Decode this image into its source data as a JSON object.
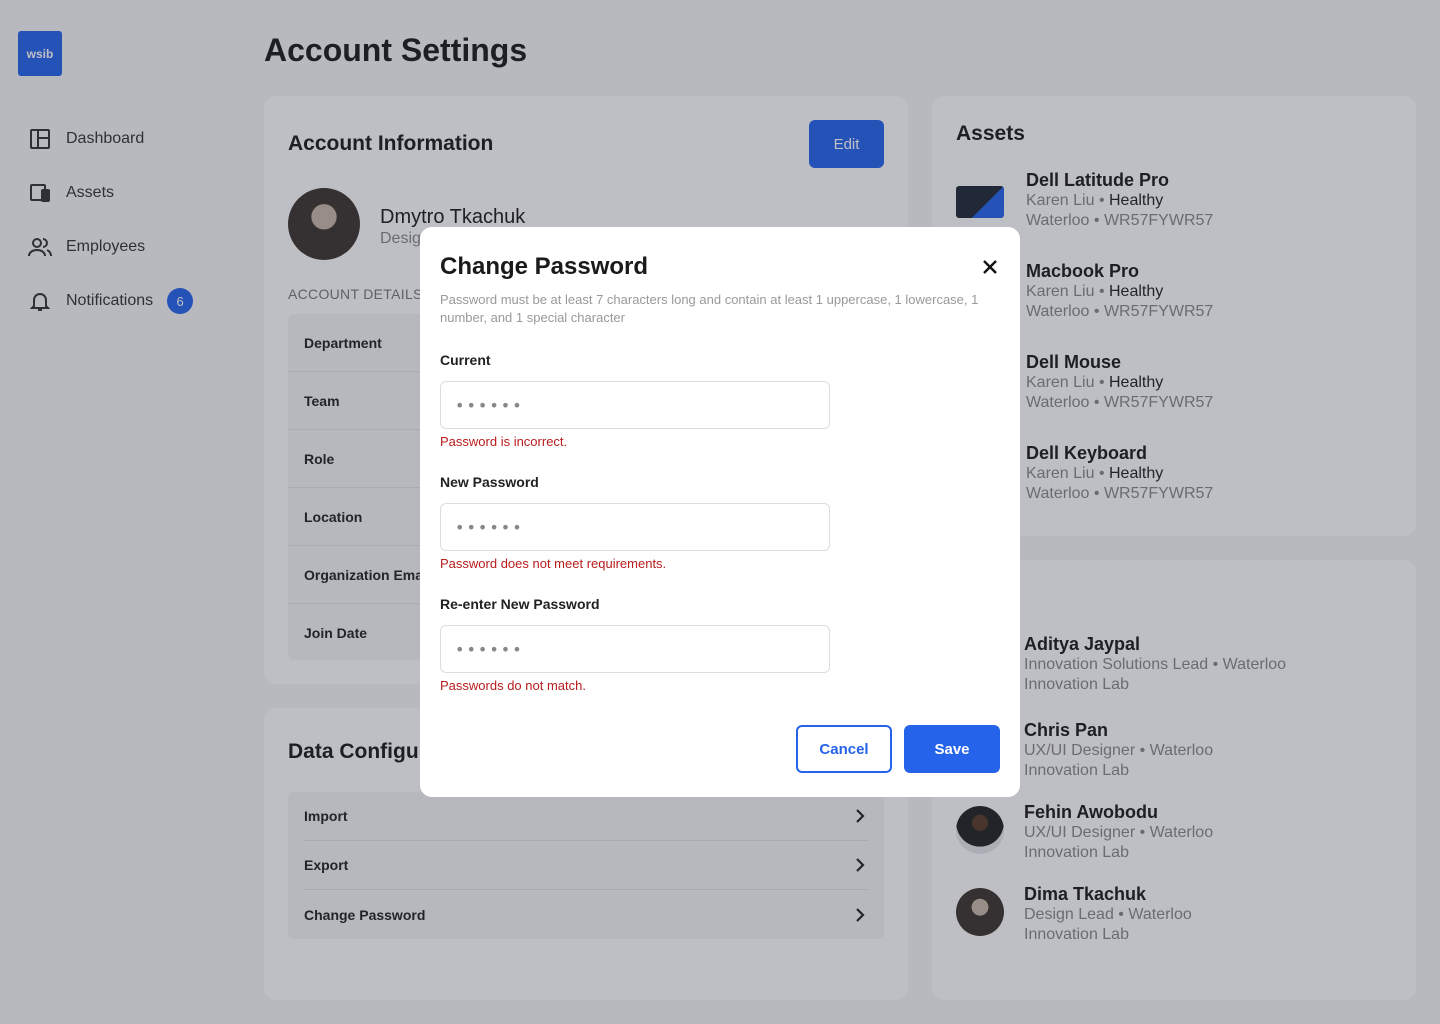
{
  "logo": {
    "text": "wsib"
  },
  "nav": [
    {
      "label": "Dashboard"
    },
    {
      "label": "Assets"
    },
    {
      "label": "Employees"
    },
    {
      "label": "Notifications",
      "badge": "6"
    }
  ],
  "page_title": "Account Settings",
  "account": {
    "title": "Account Information",
    "edit_label": "Edit",
    "name": "Dmytro Tkachuk",
    "subtitle": "Desig",
    "details_label": "ACCOUNT DETAILS",
    "details": [
      "Department",
      "Team",
      "Role",
      "Location",
      "Organization Ema",
      "Join Date"
    ]
  },
  "data_config": {
    "title": "Data Configur",
    "items": [
      "Import",
      "Export",
      "Change Password"
    ]
  },
  "assets": {
    "title": "Assets",
    "items": [
      {
        "name": "Dell Latitude Pro",
        "owner": "Karen Liu",
        "status": "Healthy",
        "location": "Waterloo",
        "serial": "WR57FYWR57"
      },
      {
        "name": "Macbook Pro",
        "owner": "Karen Liu",
        "status": "Healthy",
        "location": "Waterloo",
        "serial": "WR57FYWR57"
      },
      {
        "name": "Dell Mouse",
        "owner": "Karen Liu",
        "status": "Healthy",
        "location": "Waterloo",
        "serial": "WR57FYWR57"
      },
      {
        "name": "Dell Keyboard",
        "owner": "Karen Liu",
        "status": "Healthy",
        "location": "Waterloo",
        "serial": "WR57FYWR57"
      }
    ]
  },
  "team": {
    "members": [
      {
        "name": "Aditya Jaypal",
        "role": "Innovation Solutions Lead",
        "location": "Waterloo",
        "org": "Innovation Lab"
      },
      {
        "name": "Chris Pan",
        "role": "UX/UI Designer",
        "location": "Waterloo",
        "org": "Innovation Lab"
      },
      {
        "name": "Fehin Awobodu",
        "role": "UX/UI Designer",
        "location": "Waterloo",
        "org": "Innovation Lab"
      },
      {
        "name": "Dima Tkachuk",
        "role": "Design Lead",
        "location": "Waterloo",
        "org": "Innovation Lab"
      }
    ]
  },
  "modal": {
    "title": "Change Password",
    "description": "Password must be at least 7 characters long and contain at least 1 uppercase, 1 lowercase, 1 number, and 1 special character",
    "fields": [
      {
        "label": "Current",
        "value": "••••••",
        "error": "Password is incorrect."
      },
      {
        "label": "New Password",
        "value": "••••••",
        "error": "Password does not meet requirements."
      },
      {
        "label": "Re-enter New Password",
        "value": "••••••",
        "error": "Passwords do not match."
      }
    ],
    "cancel_label": "Cancel",
    "save_label": "Save"
  },
  "colors": {
    "accent": "#2563eb",
    "error": "#b91c1c"
  }
}
